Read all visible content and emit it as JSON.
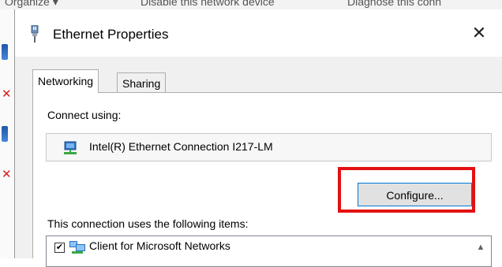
{
  "background": {
    "toolbar_items": [
      "Organize ▾",
      "Disable this network device",
      "Diagnose this conn"
    ]
  },
  "dialog": {
    "title": "Ethernet Properties",
    "close_glyph": "✕",
    "tabs": [
      {
        "label": "Networking",
        "active": true
      },
      {
        "label": "Sharing",
        "active": false
      }
    ],
    "connect_using_label": "Connect using:",
    "adapter_name": "Intel(R) Ethernet Connection I217-LM",
    "configure_label": "Configure...",
    "items_label": "This connection uses the following items:",
    "items": [
      {
        "label": "Client for Microsoft Networks",
        "checked": true,
        "check_glyph": "✔",
        "icon": "network-client-icon"
      }
    ],
    "scroll_up_glyph": "▲"
  },
  "annotation": {
    "highlight_color": "#e41111",
    "target": "configure-button"
  },
  "colors": {
    "dialog_bg": "#f0f0f0",
    "accent_border": "#0078d7",
    "highlight": "#e41111"
  }
}
